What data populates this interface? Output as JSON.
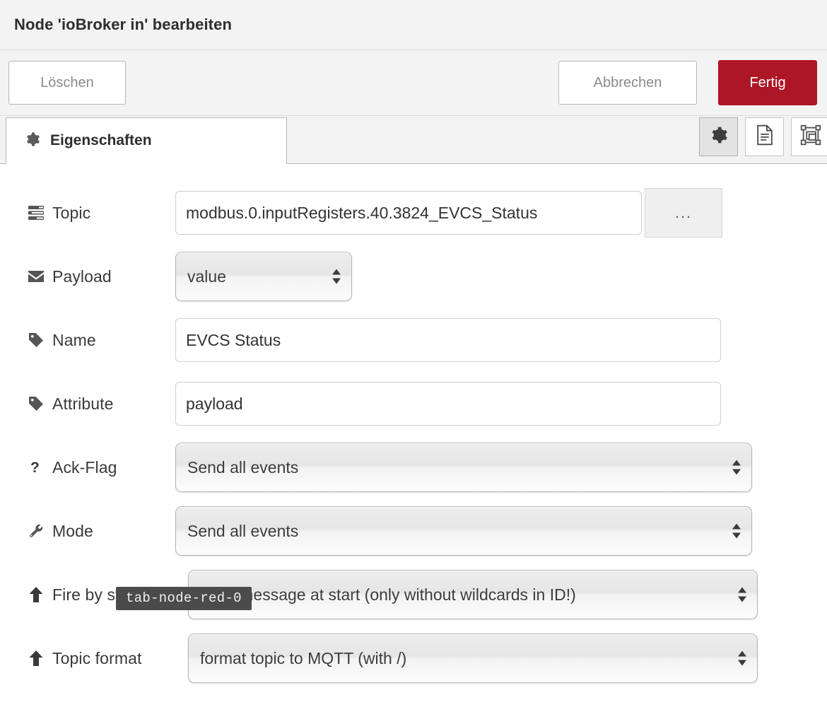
{
  "dialog": {
    "title": "Node 'ioBroker in' bearbeiten"
  },
  "buttons": {
    "delete_label": "Löschen",
    "cancel_label": "Abbrechen",
    "done_label": "Fertig",
    "done_color": "#ad1625"
  },
  "tabs": {
    "properties_label": "Eigenschaften",
    "properties_icon": "gear-icon",
    "icon_buttons": [
      {
        "name": "properties-gear-icon",
        "active": true
      },
      {
        "name": "description-document-icon",
        "active": false
      },
      {
        "name": "appearance-layout-icon",
        "active": false
      }
    ]
  },
  "form": {
    "topic": {
      "label": "Topic",
      "icon": "server-list-icon",
      "value": "modbus.0.inputRegisters.40.3824_EVCS_Status",
      "placeholder": "",
      "browse_label": "..."
    },
    "payload": {
      "label": "Payload",
      "icon": "envelope-icon",
      "value": "value"
    },
    "name": {
      "label": "Name",
      "icon": "tag-icon",
      "value": "EVCS Status",
      "placeholder": ""
    },
    "attribute": {
      "label": "Attribute",
      "icon": "tag-icon",
      "value": "payload",
      "placeholder": ""
    },
    "ack_flag": {
      "label": "Ack-Flag",
      "icon": "question-mark-icon",
      "value": "Send all events"
    },
    "mode": {
      "label": "Mode",
      "icon": "wrench-icon",
      "value": "Send all events"
    },
    "fire_by_start": {
      "label": "Fire by start",
      "icon": "arrow-up-icon",
      "value": "send message at start (only without wildcards in ID!)"
    },
    "topic_format": {
      "label": "Topic format",
      "icon": "arrow-up-icon",
      "value": "format topic to MQTT (with /)"
    }
  },
  "tooltip": {
    "text": "tab-node-red-0"
  }
}
